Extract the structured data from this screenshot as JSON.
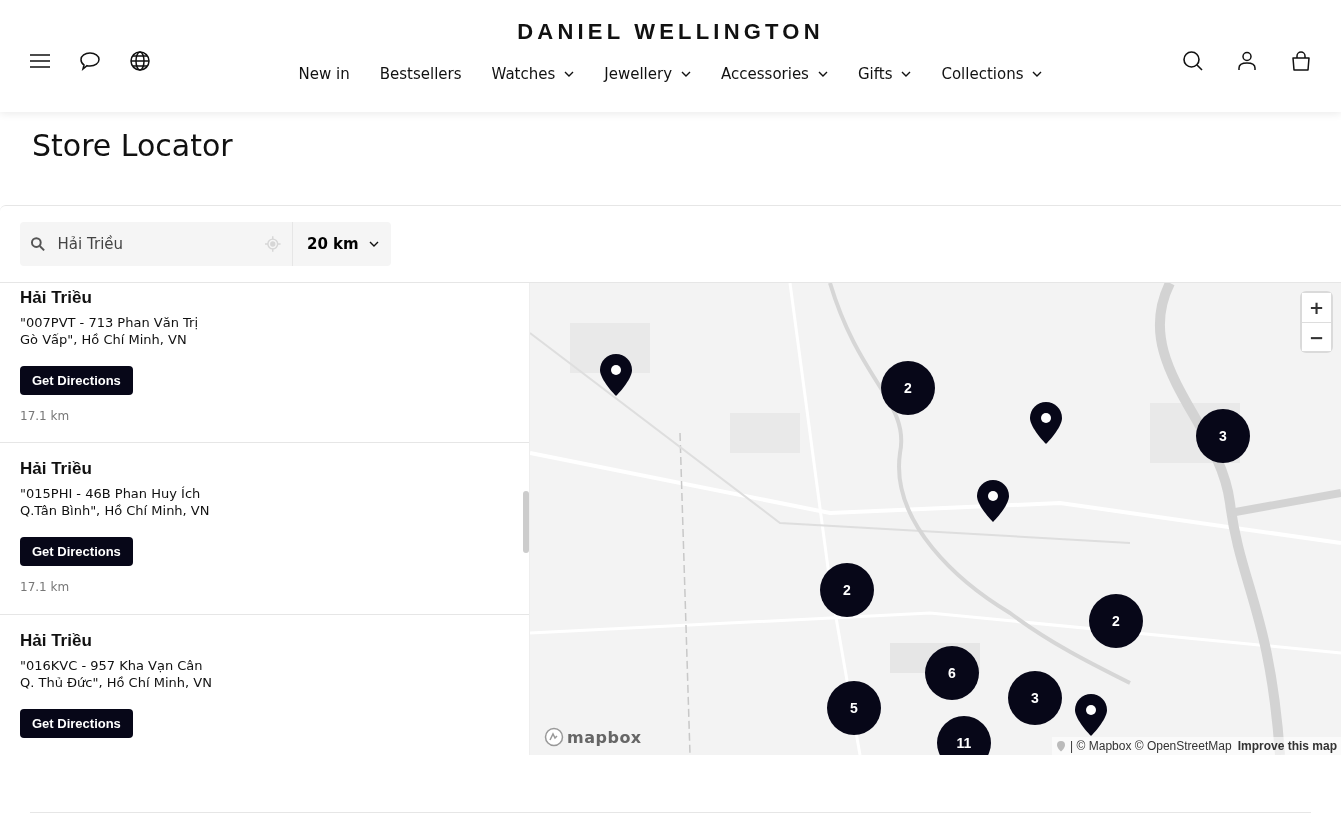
{
  "header": {
    "logo": "DANIEL WELLINGTON",
    "nav": [
      {
        "label": "New in",
        "has_menu": false
      },
      {
        "label": "Bestsellers",
        "has_menu": false
      },
      {
        "label": "Watches",
        "has_menu": true
      },
      {
        "label": "Jewellery",
        "has_menu": true
      },
      {
        "label": "Accessories",
        "has_menu": true
      },
      {
        "label": "Gifts",
        "has_menu": true
      },
      {
        "label": "Collections",
        "has_menu": true
      }
    ]
  },
  "page_title": "Store Locator",
  "search": {
    "value": "Hải Triều",
    "radius": "20 km"
  },
  "stores": [
    {
      "name": "Hải Triều",
      "address_lines": [
        "\"007PVT - 713 Phan Văn Trị",
        "Gò Vấp\", Hồ Chí Minh, VN"
      ],
      "button": "Get Directions",
      "distance": "17.1 km"
    },
    {
      "name": "Hải Triều",
      "address_lines": [
        "\"015PHI - 46B Phan Huy Ích",
        "Q.Tân Bình\", Hồ Chí Minh, VN"
      ],
      "button": "Get Directions",
      "distance": "17.1 km"
    },
    {
      "name": "Hải Triều",
      "address_lines": [
        "\"016KVC - 957 Kha Vạn Cân",
        "Q. Thủ Đức\", Hồ Chí Minh, VN"
      ],
      "button": "Get Directions"
    }
  ],
  "map": {
    "markers": [
      {
        "kind": "pin"
      },
      {
        "kind": "cluster",
        "count": "2"
      },
      {
        "kind": "pin"
      },
      {
        "kind": "cluster",
        "count": "3"
      },
      {
        "kind": "pin"
      },
      {
        "kind": "cluster",
        "count": "2"
      },
      {
        "kind": "cluster",
        "count": "2"
      },
      {
        "kind": "cluster",
        "count": "6"
      },
      {
        "kind": "cluster",
        "count": "3"
      },
      {
        "kind": "pin"
      },
      {
        "kind": "cluster",
        "count": "5"
      },
      {
        "kind": "cluster",
        "count": "11"
      }
    ],
    "zoom_in": "+",
    "zoom_out": "−",
    "logo": "mapbox",
    "attribution": "| © Mapbox © OpenStreetMap",
    "improve_link": "Improve this map"
  }
}
